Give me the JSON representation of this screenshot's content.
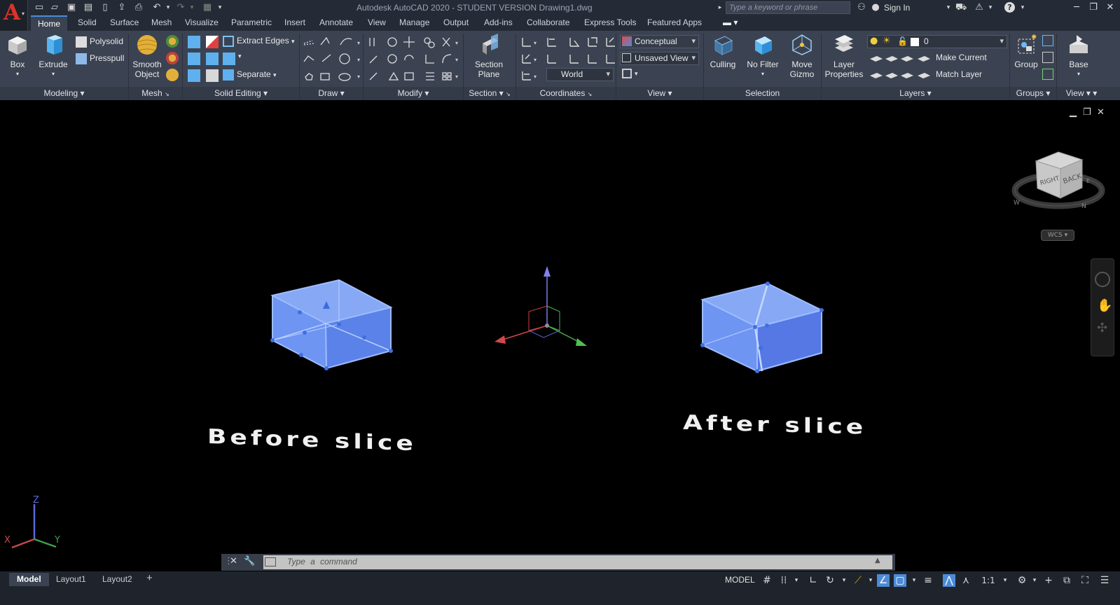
{
  "app": {
    "title": "Autodesk AutoCAD 2020 - STUDENT VERSION    Drawing1.dwg",
    "logo_letter": "A",
    "search_placeholder": "Type a keyword or phrase",
    "sign_in": "Sign In"
  },
  "tabs": [
    "Home",
    "Solid",
    "Surface",
    "Mesh",
    "Visualize",
    "Parametric",
    "Insert",
    "Annotate",
    "View",
    "Manage",
    "Output",
    "Add-ins",
    "Collaborate",
    "Express Tools",
    "Featured Apps"
  ],
  "ribbon": {
    "panels": [
      "Modeling",
      "Mesh",
      "Solid Editing",
      "Draw",
      "Modify",
      "Section",
      "Coordinates",
      "View",
      "Selection",
      "Layers",
      "Groups",
      "View"
    ],
    "modeling": {
      "box": "Box",
      "extrude": "Extrude",
      "polysolid": "Polysolid",
      "presspull": "Presspull"
    },
    "mesh": {
      "smooth_object_1": "Smooth",
      "smooth_object_2": "Object"
    },
    "solid_editing": {
      "extract_edges": "Extract Edges",
      "separate": "Separate"
    },
    "section": {
      "section_plane_1": "Section",
      "section_plane_2": "Plane"
    },
    "coordinates": {
      "world": "World"
    },
    "view": {
      "visual_style": "Conceptual",
      "named_view": "Unsaved View"
    },
    "selection": {
      "culling": "Culling",
      "no_filter": "No Filter",
      "move_gizmo_1": "Move",
      "move_gizmo_2": "Gizmo"
    },
    "layers": {
      "layer_props_1": "Layer",
      "layer_props_2": "Properties",
      "current_layer": "0",
      "make_current": "Make Current",
      "match_layer": "Match Layer"
    },
    "groups": {
      "group": "Group"
    },
    "base": {
      "base": "Base"
    }
  },
  "viewport": {
    "label_before": "Before slice",
    "label_after": "After slice",
    "viewcube_right": "RIGHT",
    "viewcube_back": "BACK",
    "wcs": "WCS",
    "ucs_x": "X",
    "ucs_y": "Y",
    "ucs_z": "Z",
    "compass_w": "W",
    "compass_n": "N",
    "compass_e": "E"
  },
  "command": {
    "placeholder": "Type a command"
  },
  "status": {
    "layouts": [
      "Model",
      "Layout1",
      "Layout2"
    ],
    "model": "MODEL",
    "scale": "1:1"
  },
  "colors": {
    "accent": "#4c8bd8",
    "ribbon_bg": "#3b4352",
    "title_bg": "#252b36",
    "solid_fill": "#6f95f2",
    "solid_edge": "#9dbcff",
    "autocad_red": "#d9332b"
  }
}
